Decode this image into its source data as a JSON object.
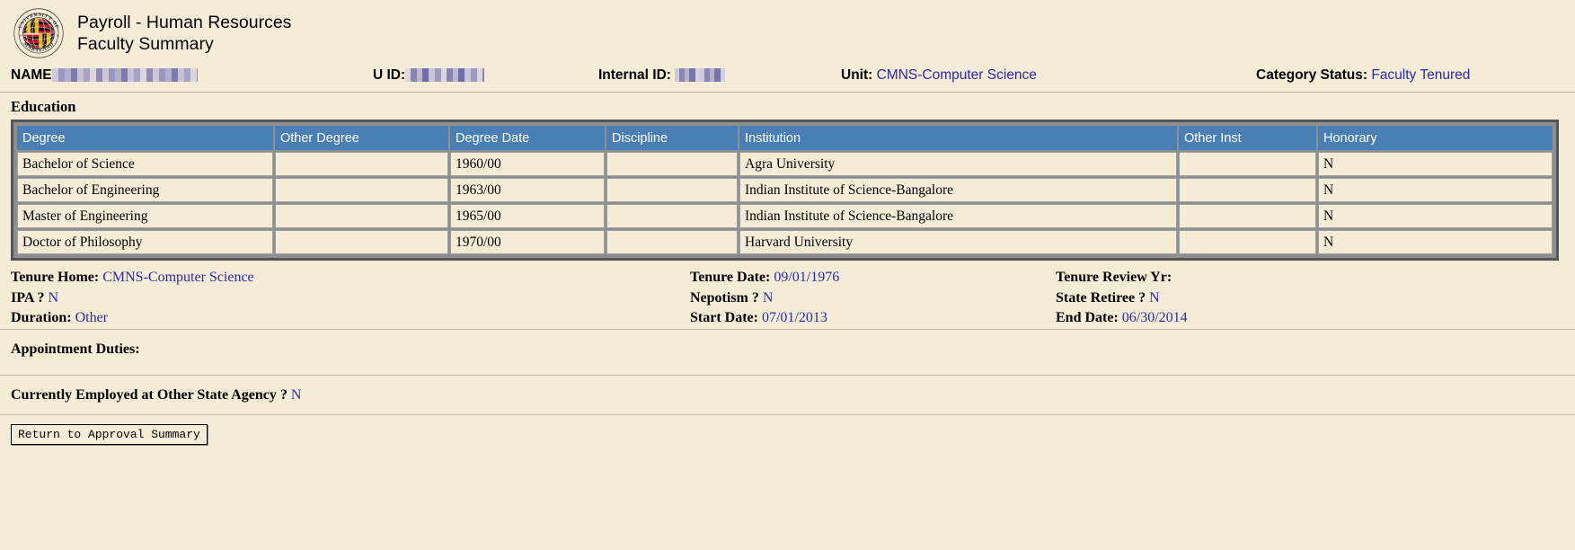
{
  "header": {
    "logo_alt": "University of Maryland seal",
    "title_line1": "Payroll - Human Resources",
    "title_line2": "Faculty Summary"
  },
  "info_bar": {
    "name_label": "NAME",
    "name_value": "",
    "uid_label": "U ID:",
    "uid_value": "",
    "internal_id_label": "Internal ID:",
    "internal_id_value": "",
    "unit_label": "Unit:",
    "unit_value": "CMNS-Computer Science",
    "category_status_label": "Category Status:",
    "category_status_value": "Faculty Tenured"
  },
  "education": {
    "section_title": "Education",
    "columns": [
      "Degree",
      "Other Degree",
      "Degree Date",
      "Discipline",
      "Institution",
      "Other Inst",
      "Honorary"
    ],
    "rows": [
      {
        "degree": "Bachelor of Science",
        "other_degree": "",
        "degree_date": "1960/00",
        "discipline": "",
        "institution": "Agra University",
        "other_inst": "",
        "honorary": "N"
      },
      {
        "degree": "Bachelor of Engineering",
        "other_degree": "",
        "degree_date": "1963/00",
        "discipline": "",
        "institution": "Indian Institute of Science-Bangalore",
        "other_inst": "",
        "honorary": "N"
      },
      {
        "degree": "Master of Engineering",
        "other_degree": "",
        "degree_date": "1965/00",
        "discipline": "",
        "institution": "Indian Institute of Science-Bangalore",
        "other_inst": "",
        "honorary": "N"
      },
      {
        "degree": "Doctor of Philosophy",
        "other_degree": "",
        "degree_date": "1970/00",
        "discipline": "",
        "institution": "Harvard University",
        "other_inst": "",
        "honorary": "N"
      }
    ]
  },
  "details": {
    "tenure_home_label": "Tenure Home:",
    "tenure_home_value": "CMNS-Computer Science",
    "ipa_label": "IPA ?",
    "ipa_value": "N",
    "duration_label": "Duration:",
    "duration_value": "Other",
    "tenure_date_label": "Tenure Date:",
    "tenure_date_value": "09/01/1976",
    "nepotism_label": "Nepotism ?",
    "nepotism_value": "N",
    "start_date_label": "Start Date:",
    "start_date_value": "07/01/2013",
    "tenure_review_yr_label": "Tenure Review Yr:",
    "tenure_review_yr_value": "",
    "state_retiree_label": "State Retiree ?",
    "state_retiree_value": "N",
    "end_date_label": "End Date:",
    "end_date_value": "06/30/2014"
  },
  "appointment": {
    "duties_label": "Appointment Duties:",
    "duties_value": "",
    "employed_other_agency_label": "Currently Employed at Other State Agency ?",
    "employed_other_agency_value": "N"
  },
  "actions": {
    "return_button_label": "Return to Approval Summary"
  },
  "colors": {
    "page_background": "#f5ecd7",
    "table_header_blue": "#4a7fb5",
    "link_blue": "#2a2ab0",
    "table_frame": "#555555"
  }
}
